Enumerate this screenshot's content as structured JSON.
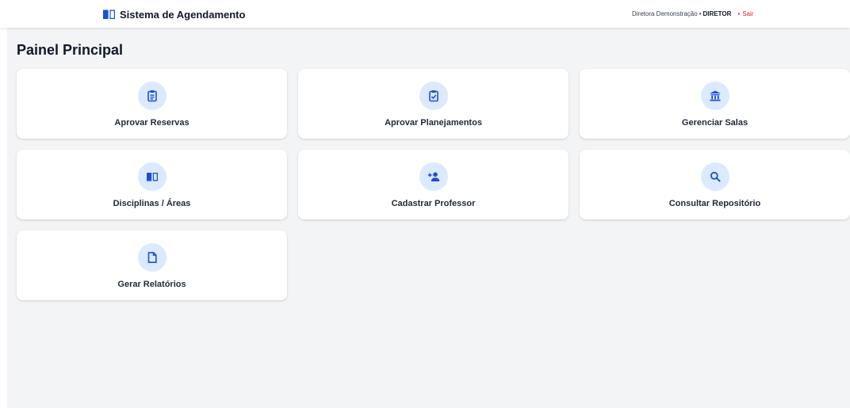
{
  "header": {
    "app_title": "Sistema de Agendamento",
    "brand_icon": "book-open-icon",
    "user_name": "Diretora Demonstração",
    "separator": "•",
    "user_role": "DIRETOR",
    "logout_bullet": "•",
    "logout_label": "Sair"
  },
  "main": {
    "page_title": "Painel Principal"
  },
  "cards": [
    {
      "label": "Aprovar Reservas",
      "icon": "clipboard-list-icon"
    },
    {
      "label": "Aprovar Planejamentos",
      "icon": "clipboard-check-icon"
    },
    {
      "label": "Gerenciar Salas",
      "icon": "bank-building-icon"
    },
    {
      "label": "Disciplinas / Áreas",
      "icon": "book-open-icon"
    },
    {
      "label": "Cadastrar Professor",
      "icon": "user-plus-icon"
    },
    {
      "label": "Consultar Repositório",
      "icon": "search-icon"
    },
    {
      "label": "Gerar Relatórios",
      "icon": "file-icon"
    }
  ],
  "colors": {
    "accent": "#1d4ed8",
    "icon_bg": "#dbeafe",
    "page_bg": "#f3f4f6",
    "logout": "#dc2626"
  }
}
